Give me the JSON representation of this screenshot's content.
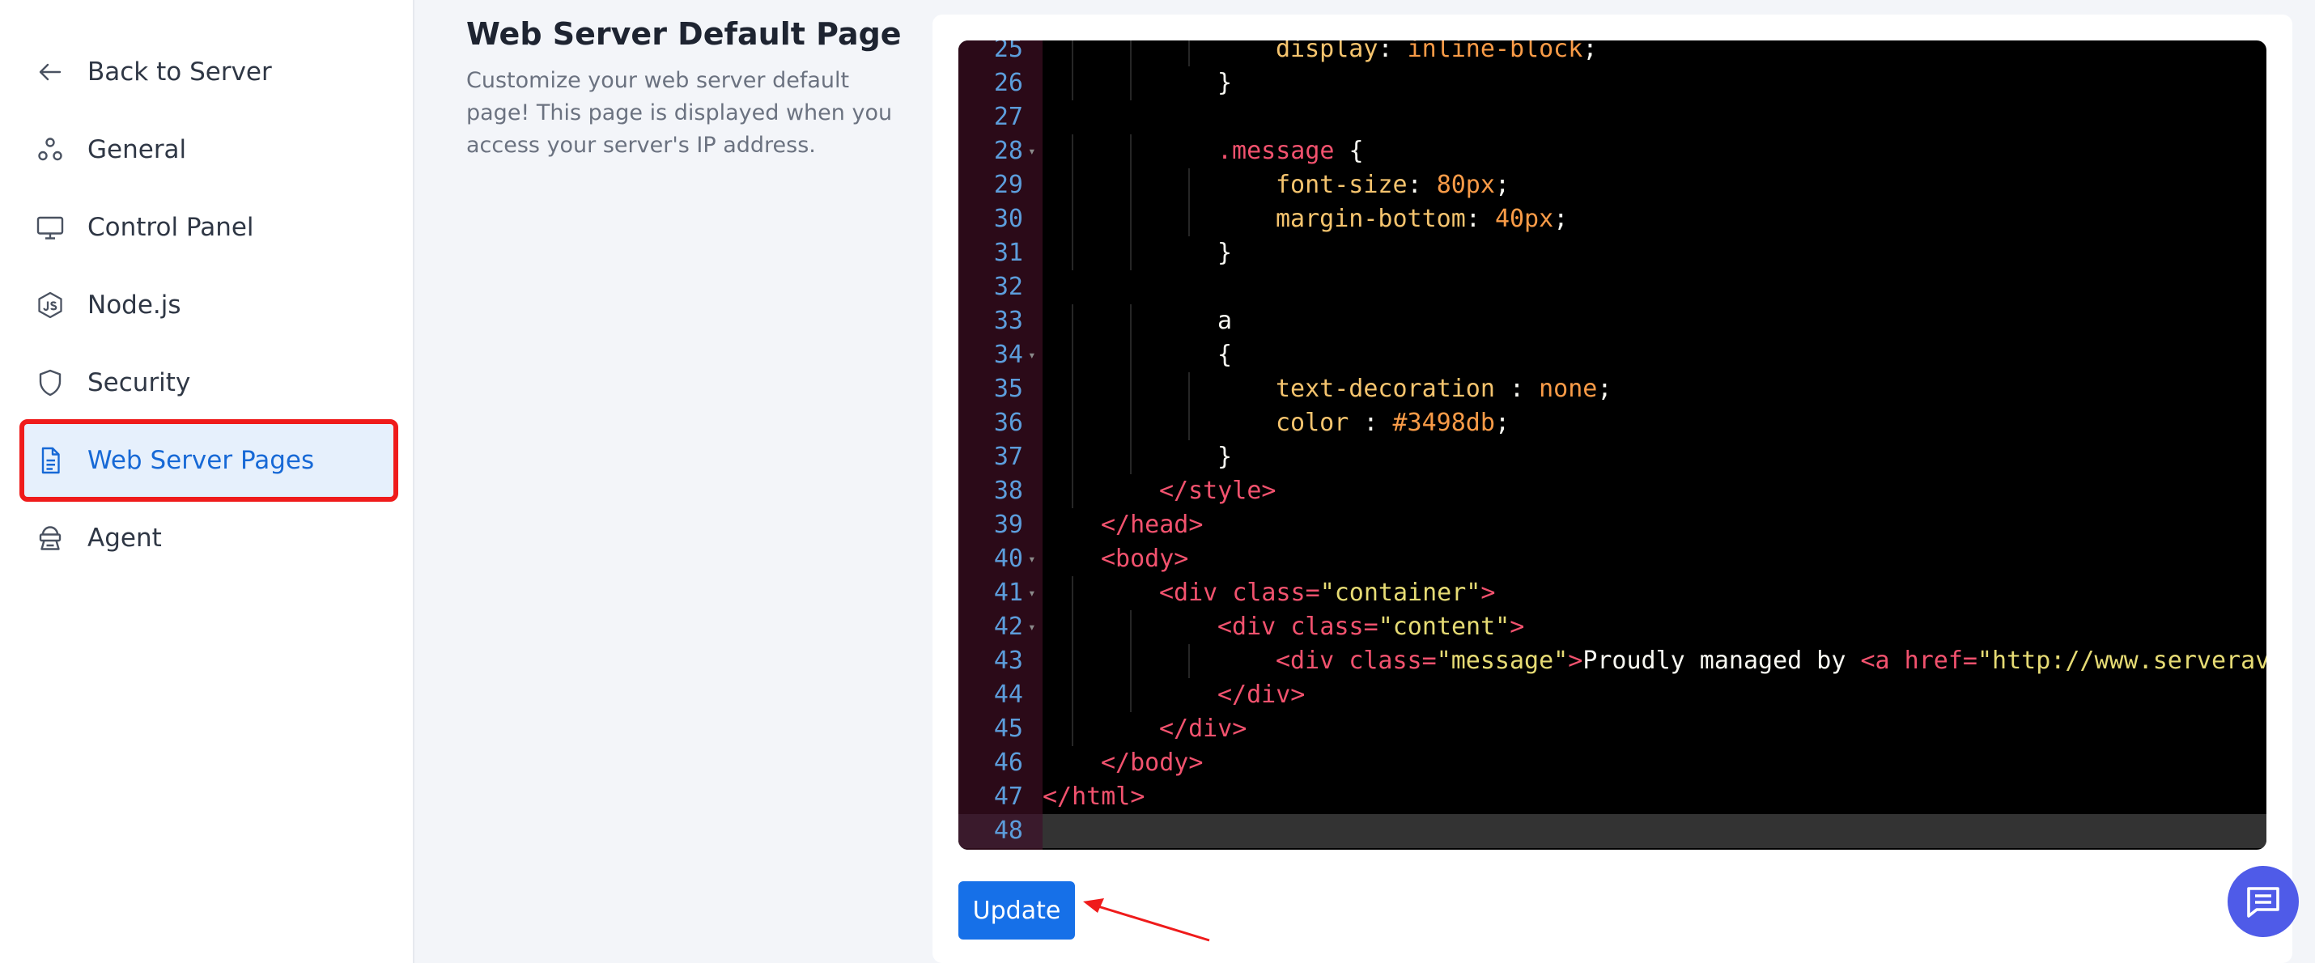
{
  "sidebar": {
    "items": [
      {
        "label": "Back to Server",
        "icon": "arrow-left-icon"
      },
      {
        "label": "General",
        "icon": "nodes-icon"
      },
      {
        "label": "Control Panel",
        "icon": "monitor-icon"
      },
      {
        "label": "Node.js",
        "icon": "nodejs-icon"
      },
      {
        "label": "Security",
        "icon": "shield-icon"
      },
      {
        "label": "Web Server Pages",
        "icon": "document-icon",
        "active": true
      },
      {
        "label": "Agent",
        "icon": "agent-icon"
      }
    ]
  },
  "page": {
    "title": "Web Server Default Page",
    "description": "Customize your web server default page! This page is displayed when you access your server's IP address."
  },
  "editor": {
    "lines": [
      {
        "n": "25",
        "tokens": [
          [
            "prop",
            "display"
          ],
          [
            "plain",
            ": "
          ],
          [
            "val",
            "inline-block"
          ],
          [
            "plain",
            ";"
          ]
        ],
        "indent": 4
      },
      {
        "n": "26",
        "tokens": [
          [
            "plain",
            "}"
          ]
        ],
        "indent": 3
      },
      {
        "n": "27",
        "tokens": [],
        "indent": 0
      },
      {
        "n": "28",
        "fold": true,
        "tokens": [
          [
            "sel",
            ".message"
          ],
          [
            "plain",
            " {"
          ]
        ],
        "indent": 3
      },
      {
        "n": "29",
        "tokens": [
          [
            "prop",
            "font-size"
          ],
          [
            "plain",
            ": "
          ],
          [
            "val",
            "80px"
          ],
          [
            "plain",
            ";"
          ]
        ],
        "indent": 4
      },
      {
        "n": "30",
        "tokens": [
          [
            "prop",
            "margin-bottom"
          ],
          [
            "plain",
            ": "
          ],
          [
            "val",
            "40px"
          ],
          [
            "plain",
            ";"
          ]
        ],
        "indent": 4
      },
      {
        "n": "31",
        "tokens": [
          [
            "plain",
            "}"
          ]
        ],
        "indent": 3
      },
      {
        "n": "32",
        "tokens": [],
        "indent": 0
      },
      {
        "n": "33",
        "tokens": [
          [
            "plain",
            "a"
          ]
        ],
        "indent": 3
      },
      {
        "n": "34",
        "fold": true,
        "tokens": [
          [
            "plain",
            "{"
          ]
        ],
        "indent": 3
      },
      {
        "n": "35",
        "tokens": [
          [
            "prop",
            "text-decoration"
          ],
          [
            "plain",
            " : "
          ],
          [
            "val",
            "none"
          ],
          [
            "plain",
            ";"
          ]
        ],
        "indent": 4
      },
      {
        "n": "36",
        "tokens": [
          [
            "prop",
            "color"
          ],
          [
            "plain",
            " : "
          ],
          [
            "val",
            "#3498db"
          ],
          [
            "plain",
            ";"
          ]
        ],
        "indent": 4
      },
      {
        "n": "37",
        "tokens": [
          [
            "plain",
            "}"
          ]
        ],
        "indent": 3
      },
      {
        "n": "38",
        "tokens": [
          [
            "tag",
            "</style>"
          ]
        ],
        "indent": 2
      },
      {
        "n": "39",
        "tokens": [
          [
            "tag",
            "</head>"
          ]
        ],
        "indent": 1
      },
      {
        "n": "40",
        "fold": true,
        "tokens": [
          [
            "tag",
            "<body>"
          ]
        ],
        "indent": 1
      },
      {
        "n": "41",
        "fold": true,
        "tokens": [
          [
            "tag",
            "<div "
          ],
          [
            "attr",
            "class="
          ],
          [
            "str",
            "\"container\""
          ],
          [
            "tag",
            ">"
          ]
        ],
        "indent": 2
      },
      {
        "n": "42",
        "fold": true,
        "tokens": [
          [
            "tag",
            "<div "
          ],
          [
            "attr",
            "class="
          ],
          [
            "str",
            "\"content\""
          ],
          [
            "tag",
            ">"
          ]
        ],
        "indent": 3
      },
      {
        "n": "43",
        "tokens": [
          [
            "tag",
            "<div "
          ],
          [
            "attr",
            "class="
          ],
          [
            "str",
            "\"message\""
          ],
          [
            "tag",
            ">"
          ],
          [
            "plain",
            "Proudly managed by "
          ],
          [
            "tag",
            "<a "
          ],
          [
            "attr",
            "href="
          ],
          [
            "str",
            "\"http://www.serveravo"
          ]
        ],
        "indent": 4
      },
      {
        "n": "44",
        "tokens": [
          [
            "tag",
            "</div>"
          ]
        ],
        "indent": 3
      },
      {
        "n": "45",
        "tokens": [
          [
            "tag",
            "</div>"
          ]
        ],
        "indent": 2
      },
      {
        "n": "46",
        "tokens": [
          [
            "tag",
            "</body>"
          ]
        ],
        "indent": 1
      },
      {
        "n": "47",
        "tokens": [
          [
            "tag",
            "</html>"
          ]
        ],
        "indent": 0
      },
      {
        "n": "48",
        "tokens": [],
        "indent": 0,
        "current": true
      }
    ]
  },
  "actions": {
    "update_label": "Update"
  },
  "colors": {
    "accent": "#1670e8",
    "active_bg": "#e6f0fc",
    "highlight_box": "#ef1b1b",
    "chat_button": "#4f5be8"
  },
  "chat": {
    "icon": "chat-icon"
  }
}
